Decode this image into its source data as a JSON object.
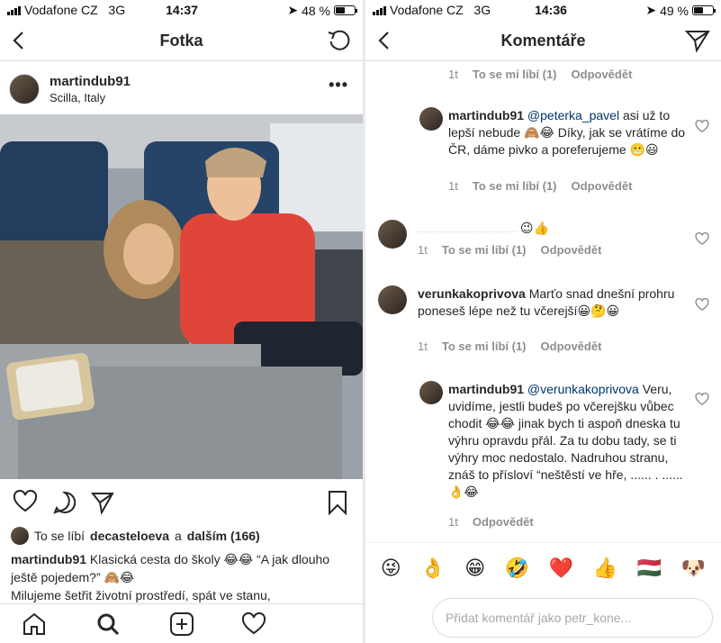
{
  "left": {
    "status": {
      "carrier": "Vodafone CZ",
      "network": "3G",
      "time": "14:37",
      "battery": "48 %",
      "battery_level": 0.48
    },
    "title": "Fotka",
    "post": {
      "username": "martindub91",
      "location": "Scilla, Italy",
      "more": "•••",
      "likes": {
        "prefix": "To se líbí",
        "user": "decasteloeva",
        "joiner": "a",
        "others": "dalším (166)"
      },
      "caption_user": "martindub91",
      "caption_text": "Klasická cesta do školy 😂😂 “A jak dlouho ještě pojedem?” 🙈😂",
      "caption_more": "Milujeme šetřit životní prostředí, spát ve stanu,"
    },
    "icons": {
      "back": "back-icon",
      "refresh": "refresh-icon",
      "heart": "heart-icon",
      "comment": "comment-icon",
      "share": "share-icon",
      "bookmark": "bookmark-icon"
    },
    "tabs": [
      "home-icon",
      "search-icon",
      "add-icon",
      "activity-icon"
    ]
  },
  "right": {
    "status": {
      "carrier": "Vodafone CZ",
      "network": "3G",
      "time": "14:36",
      "battery": "49 %",
      "battery_level": 0.49
    },
    "title": "Komentáře",
    "comments": [
      {
        "meta": {
          "time": "1t",
          "like": "To se mi líbí (1)",
          "reply": "Odpovědět"
        }
      },
      {
        "user": "martindub91",
        "mention": "@peterka_pavel",
        "text": "asi už to lepší nebude 🙈😂 Díky, jak se vrátíme do ČR, dáme pivko a poreferujeme 😬😃",
        "meta": {
          "time": "1t",
          "like": "To se mi líbí (1)",
          "reply": "Odpovědět"
        }
      },
      {
        "user": "",
        "text": "😉👍",
        "meta": {
          "time": "1t",
          "like": "To se mi líbí (1)",
          "reply": "Odpovědět"
        }
      },
      {
        "user": "verunkakoprivova",
        "text": "Marťo snad dnešní prohru poneseš lépe než tu včerejší😀🤔😀",
        "meta": {
          "time": "1t",
          "like": "To se mi líbí (1)",
          "reply": "Odpovědět"
        }
      },
      {
        "user": "martindub91",
        "mention": "@verunkakoprivova",
        "text": "Veru, uvidíme, jestli budeš po včerejšku vůbec chodit 😂😂 jinak bych ti aspoň dneska tu výhru opravdu přál. Za tu dobu tady, se ti výhry moc nedostalo. Nadruhou stranu, znáš to přísloví “neštěstí ve hře, ...... . ...... 👌😂",
        "meta": {
          "time": "1t",
          "reply": "Odpovědět"
        }
      }
    ],
    "emojis": [
      "😜",
      "👌",
      "😁",
      "🤣",
      "❤️",
      "👍",
      "🇭🇺",
      "🐶"
    ],
    "input": {
      "placeholder": "Přidat komentář jako petr_kone..."
    }
  }
}
